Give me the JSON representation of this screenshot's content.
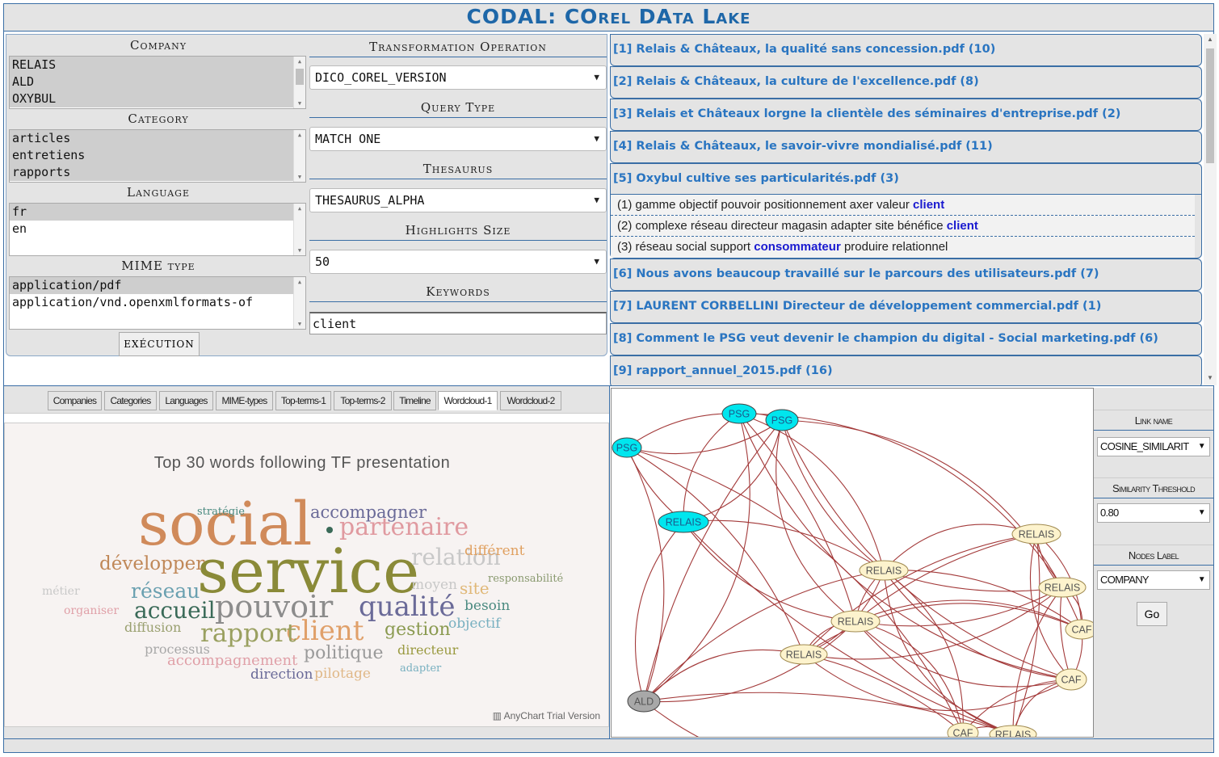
{
  "app": {
    "title": "CODAL:  COrel DAta Lake"
  },
  "form": {
    "company": {
      "label": "Company",
      "options": [
        "RELAIS",
        "ALD",
        "OXYBUL"
      ]
    },
    "category": {
      "label": "Category",
      "options": [
        "articles",
        "entretiens",
        "rapports"
      ]
    },
    "language": {
      "label": "Language",
      "options": [
        "fr",
        "en"
      ]
    },
    "mime": {
      "label": "MIME type",
      "options": [
        "application/pdf",
        "application/vnd.openxmlformats-of"
      ]
    },
    "transformation": {
      "label": "Transformation Operation",
      "value": "DICO_COREL_VERSION"
    },
    "query_type": {
      "label": "Query Type",
      "value": "MATCH ONE"
    },
    "thesaurus": {
      "label": "Thesaurus",
      "value": "THESAURUS_ALPHA"
    },
    "highlights": {
      "label": "Highlights Size",
      "value": "50"
    },
    "keywords": {
      "label": "Keywords",
      "value": "client"
    },
    "execute_label": "EXÉCUTION"
  },
  "results": [
    {
      "title": "[1] Relais & Châteaux, la qualité sans concession.pdf (10)"
    },
    {
      "title": "[2] Relais & Châteaux, la culture de l'excellence.pdf (8)"
    },
    {
      "title": "[3] Relais et Châteaux lorgne la clientèle des séminaires d'entreprise.pdf (2)"
    },
    {
      "title": "[4] Relais & Châteaux, le savoir-vivre mondialisé.pdf (11)"
    },
    {
      "title": "[5] Oxybul cultive ses particularités.pdf (3)",
      "snippets": [
        {
          "pre": "(1) gamme objectif pouvoir positionnement axer valeur ",
          "hl": "client",
          "post": ""
        },
        {
          "pre": "(2) complexe réseau directeur magasin adapter site bénéfice ",
          "hl": "client",
          "post": ""
        },
        {
          "pre": "(3) réseau social support ",
          "hl": "consommateur",
          "post": " produire relationnel"
        }
      ]
    },
    {
      "title": "[6] Nous avons beaucoup travaillé sur le parcours des utilisateurs.pdf (7)"
    },
    {
      "title": "[7] LAURENT CORBELLINI Directeur de développement commercial.pdf (1)"
    },
    {
      "title": "[8] Comment le PSG veut devenir le champion du digital - Social marketing.pdf (6)"
    },
    {
      "title": "[9] rapport_annuel_2015.pdf (16)"
    },
    {
      "title": ""
    }
  ],
  "tabs": [
    "Companies",
    "Categories",
    "Languages",
    "MIME-types",
    "Top-terms-1",
    "Top-terms-2",
    "Timeline",
    "Wordcloud-1",
    "Wordcloud-2"
  ],
  "active_tab": "Wordcloud-1",
  "wordcloud": {
    "title": "Top 30 words following TF presentation",
    "trial_text": "AnyChart Trial Version",
    "words": [
      {
        "text": "social",
        "color": "#d08a5a"
      },
      {
        "text": "service",
        "color": "#8a8a38"
      },
      {
        "text": "pouvoir",
        "color": "#8c8c8c"
      },
      {
        "text": "qualité",
        "color": "#6a6a98"
      },
      {
        "text": "client",
        "color": "#e0a06a"
      },
      {
        "text": "partenaire",
        "color": "#e09aa0"
      },
      {
        "text": "rapport",
        "color": "#9aa060"
      },
      {
        "text": "accueil",
        "color": "#3a6a58"
      },
      {
        "text": "relation",
        "color": "#c8c8c8"
      },
      {
        "text": "réseau",
        "color": "#6aa0b0"
      },
      {
        "text": "développer",
        "color": "#c08858"
      },
      {
        "text": "accompagner",
        "color": "#6a6a98"
      },
      {
        "text": "gestion",
        "color": "#8a9a50"
      },
      {
        "text": "politique",
        "color": "#9a9a9a"
      },
      {
        "text": "différent",
        "color": "#e0a060"
      },
      {
        "text": "site",
        "color": "#e0b878"
      },
      {
        "text": "besoin",
        "color": "#4a8a80"
      },
      {
        "text": "objectif",
        "color": "#78b0c0"
      },
      {
        "text": "moyen",
        "color": "#c8c8c8"
      },
      {
        "text": "directeur",
        "color": "#9a9a40"
      },
      {
        "text": "accompagnement",
        "color": "#e0a0a8"
      },
      {
        "text": "direction",
        "color": "#6a6a98"
      },
      {
        "text": "pilotage",
        "color": "#e0b888"
      },
      {
        "text": "processus",
        "color": "#a8a8a8"
      },
      {
        "text": "diffusion",
        "color": "#9aa070"
      },
      {
        "text": "organiser",
        "color": "#e0a0a8"
      },
      {
        "text": "responsabilité",
        "color": "#8a9a70"
      },
      {
        "text": "adapter",
        "color": "#78b0c0"
      },
      {
        "text": "stratégie",
        "color": "#4a8a80"
      },
      {
        "text": "métier",
        "color": "#c8c8c8"
      }
    ]
  },
  "graph": {
    "node_colors": {
      "highlight": "#00e6ee",
      "company": "#fdf3cd",
      "ald": "#a8a8a8",
      "edge": "#a33a3a"
    },
    "nodes": [
      {
        "label": "PSG",
        "kind": "highlight"
      },
      {
        "label": "PSG",
        "kind": "highlight"
      },
      {
        "label": "PSG",
        "kind": "highlight"
      },
      {
        "label": "RELAIS",
        "kind": "highlight"
      },
      {
        "label": "RELAIS",
        "kind": "company"
      },
      {
        "label": "RELAIS",
        "kind": "company"
      },
      {
        "label": "RELAIS",
        "kind": "company"
      },
      {
        "label": "RELAIS",
        "kind": "company"
      },
      {
        "label": "RELAIS",
        "kind": "company"
      },
      {
        "label": "CAF",
        "kind": "company"
      },
      {
        "label": "CAF",
        "kind": "company"
      },
      {
        "label": "CAF",
        "kind": "company"
      },
      {
        "label": "RELAIS",
        "kind": "company"
      },
      {
        "label": "ALD",
        "kind": "ald"
      }
    ]
  },
  "controls": {
    "link_name": {
      "label": "Link name",
      "value": "COSINE_SIMILARIT"
    },
    "similarity": {
      "label": "Similarity Threshold",
      "value": "0.80"
    },
    "nodes_label": {
      "label": "Nodes Label",
      "value": "COMPANY"
    },
    "go_label": "Go"
  }
}
